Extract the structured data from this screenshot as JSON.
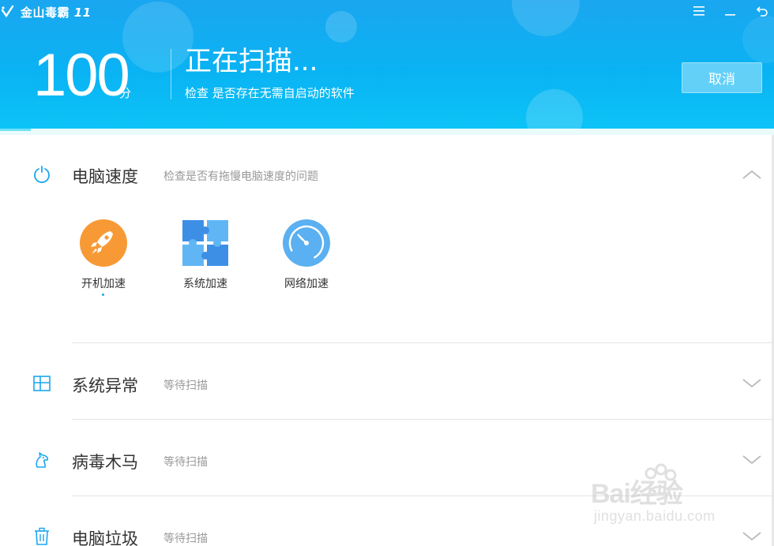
{
  "app": {
    "title": "金山毒霸",
    "version": "11"
  },
  "window_controls": [
    "menu-icon",
    "minimize-icon",
    "return-icon"
  ],
  "scan": {
    "score": "100",
    "score_unit": "分",
    "title": "正在扫描...",
    "subtitle": "检查 是否存在无需自启动的软件",
    "cancel_label": "取消",
    "progress": 0.04
  },
  "sections": [
    {
      "title": "电脑速度",
      "status": "检查是否有拖慢电脑速度的问题",
      "icon": "power-icon",
      "expanded": true,
      "tools": [
        {
          "label": "开机加速",
          "icon": "rocket-icon",
          "color": "#f79a35"
        },
        {
          "label": "系统加速",
          "icon": "puzzle-icon",
          "color": "#4aa6ef"
        },
        {
          "label": "网络加速",
          "icon": "speedometer-icon",
          "color": "#4aa6ef"
        }
      ]
    },
    {
      "title": "系统异常",
      "status": "等待扫描",
      "icon": "windows-icon",
      "expanded": false
    },
    {
      "title": "病毒木马",
      "status": "等待扫描",
      "icon": "horse-icon",
      "expanded": false
    },
    {
      "title": "电脑垃圾",
      "status": "等待扫描",
      "icon": "trash-icon",
      "expanded": false
    }
  ],
  "watermark": {
    "brand": "Bai经验",
    "url": "jingyan.baidu.com"
  },
  "colors": {
    "header_top": "#1aa6f0",
    "header_bottom": "#0cc4f7",
    "accent": "#1aa6f0",
    "orange": "#f79a35"
  }
}
